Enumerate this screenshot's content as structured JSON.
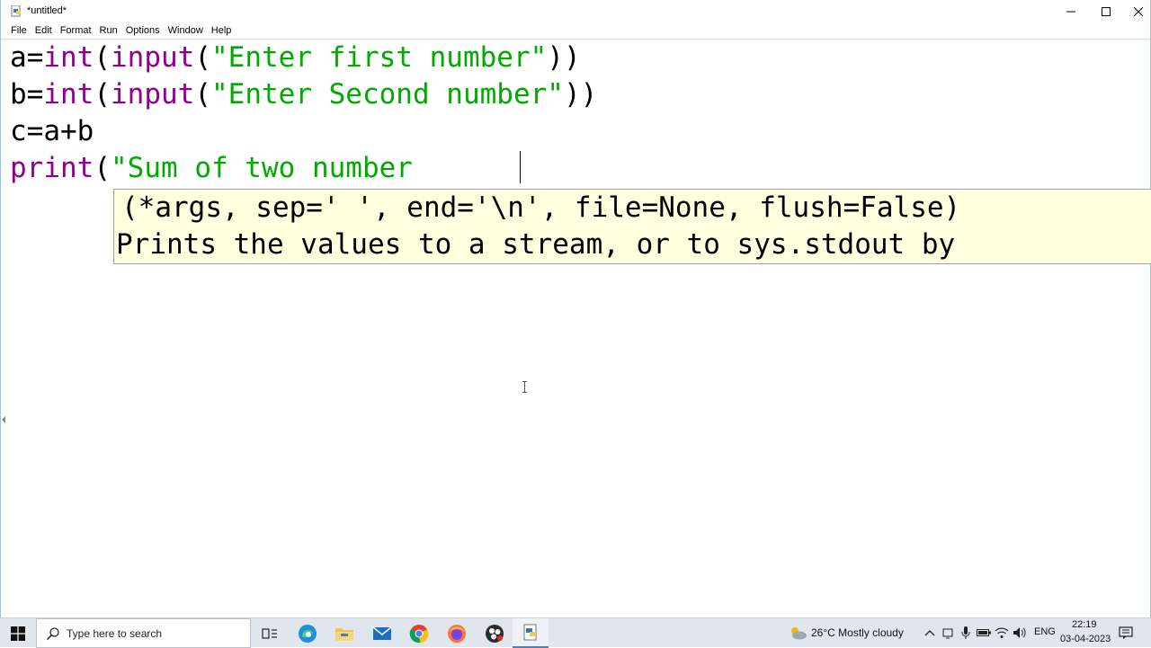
{
  "window": {
    "title": "*untitled*",
    "menu": [
      "File",
      "Edit",
      "Format",
      "Run",
      "Options",
      "Window",
      "Help"
    ]
  },
  "editor": {
    "lines": [
      [
        {
          "text": "a=",
          "kind": "plain"
        },
        {
          "text": "int",
          "kind": "builtin"
        },
        {
          "text": "(",
          "kind": "plain"
        },
        {
          "text": "input",
          "kind": "builtin"
        },
        {
          "text": "(",
          "kind": "plain"
        },
        {
          "text": "\"Enter first number\"",
          "kind": "string"
        },
        {
          "text": "))",
          "kind": "plain"
        }
      ],
      [
        {
          "text": "b=",
          "kind": "plain"
        },
        {
          "text": "int",
          "kind": "builtin"
        },
        {
          "text": "(",
          "kind": "plain"
        },
        {
          "text": "input",
          "kind": "builtin"
        },
        {
          "text": "(",
          "kind": "plain"
        },
        {
          "text": "\"Enter Second number\"",
          "kind": "string"
        },
        {
          "text": "))",
          "kind": "plain"
        }
      ],
      [
        {
          "text": "c=a+b",
          "kind": "plain"
        }
      ],
      [
        {
          "text": "print",
          "kind": "builtin"
        },
        {
          "text": "(",
          "kind": "plain"
        },
        {
          "text": "\"Sum of two number ",
          "kind": "string"
        }
      ]
    ],
    "calltip": {
      "signature": "(*args, sep=' ', end='\\n', file=None, flush=False)",
      "doc": "Prints the values to a stream, or to sys.stdout by"
    }
  },
  "taskbar": {
    "search_placeholder": "Type here to search",
    "weather": "26°C  Mostly cloudy",
    "language": "ENG",
    "time": "22:19",
    "date": "03-04-2023",
    "apps": [
      "task-view",
      "edge",
      "file-explorer",
      "mail",
      "chrome",
      "firefox",
      "obs",
      "idle"
    ]
  },
  "colors": {
    "builtin": "#900090",
    "string": "#00aa00",
    "calltip_bg": "#ffffe0",
    "taskbar_bg": "#dfe6ee"
  }
}
